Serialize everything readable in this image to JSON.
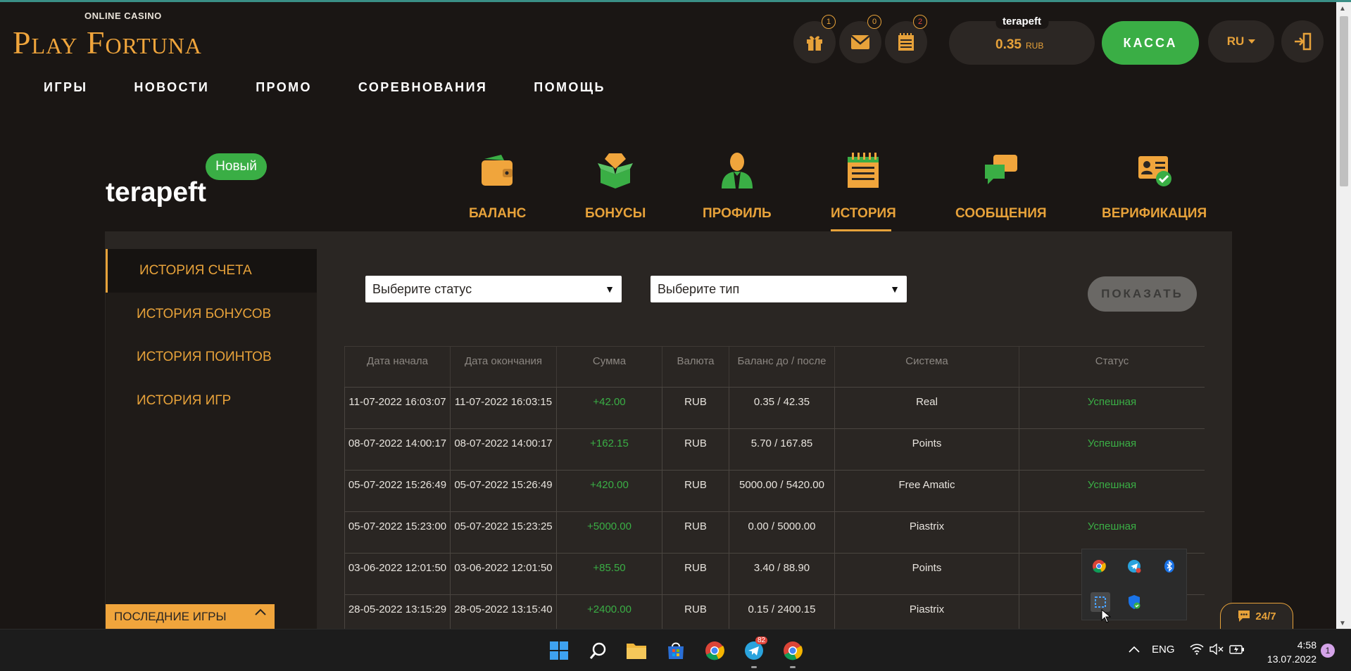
{
  "logo": {
    "sub": "ONLINE CASINO",
    "main": "Play Fortuna"
  },
  "nav": [
    "ИГРЫ",
    "НОВОСТИ",
    "ПРОМО",
    "СОРЕВНОВАНИЯ",
    "ПОМОЩЬ"
  ],
  "header": {
    "gift_count": "1",
    "mail_count": "0",
    "notes_count": "2",
    "username": "terapeft",
    "balance": "0.35",
    "currency": "RUB",
    "kassa": "КАССА",
    "lang": "RU"
  },
  "profile": {
    "username": "terapeft",
    "badge": "Новый",
    "tabs": [
      "БАЛАНС",
      "БОНУСЫ",
      "ПРОФИЛЬ",
      "ИСТОРИЯ",
      "СООБЩЕНИЯ",
      "ВЕРИФИКАЦИЯ"
    ],
    "active_tab": "ИСТОРИЯ"
  },
  "sidebar": {
    "items": [
      "ИСТОРИЯ СЧЕТА",
      "ИСТОРИЯ БОНУСОВ",
      "ИСТОРИЯ ПОИНТОВ",
      "ИСТОРИЯ ИГР"
    ],
    "last_games": "ПОСЛЕДНИЕ ИГРЫ"
  },
  "filters": {
    "status_placeholder": "Выберите статус",
    "type_placeholder": "Выберите тип",
    "show": "ПОКАЗАТЬ"
  },
  "table": {
    "headers": [
      "Дата начала",
      "Дата окончания",
      "Сумма",
      "Валюта",
      "Баланс до / после",
      "Система",
      "Статус"
    ],
    "rows": [
      {
        "start": "11-07-2022 16:03:07",
        "end": "11-07-2022 16:03:15",
        "amount": "+42.00",
        "cur": "RUB",
        "balance": "0.35 / 42.35",
        "system": "Real",
        "status": "Успешная"
      },
      {
        "start": "08-07-2022 14:00:17",
        "end": "08-07-2022 14:00:17",
        "amount": "+162.15",
        "cur": "RUB",
        "balance": "5.70 / 167.85",
        "system": "Points",
        "status": "Успешная"
      },
      {
        "start": "05-07-2022 15:26:49",
        "end": "05-07-2022 15:26:49",
        "amount": "+420.00",
        "cur": "RUB",
        "balance": "5000.00 / 5420.00",
        "system": "Free Amatic",
        "status": "Успешная"
      },
      {
        "start": "05-07-2022 15:23:00",
        "end": "05-07-2022 15:23:25",
        "amount": "+5000.00",
        "cur": "RUB",
        "balance": "0.00 / 5000.00",
        "system": "Piastrix",
        "status": "Успешная"
      },
      {
        "start": "03-06-2022 12:01:50",
        "end": "03-06-2022 12:01:50",
        "amount": "+85.50",
        "cur": "RUB",
        "balance": "3.40 / 88.90",
        "system": "Points",
        "status": ""
      },
      {
        "start": "28-05-2022 13:15:29",
        "end": "28-05-2022 13:15:40",
        "amount": "+2400.00",
        "cur": "RUB",
        "balance": "0.15 / 2400.15",
        "system": "Piastrix",
        "status": ""
      }
    ]
  },
  "chat": {
    "label": "24/7"
  },
  "taskbar": {
    "telegram_badge": "82",
    "lang": "ENG",
    "time": "4:58",
    "date": "13.07.2022",
    "notifications": "1"
  }
}
